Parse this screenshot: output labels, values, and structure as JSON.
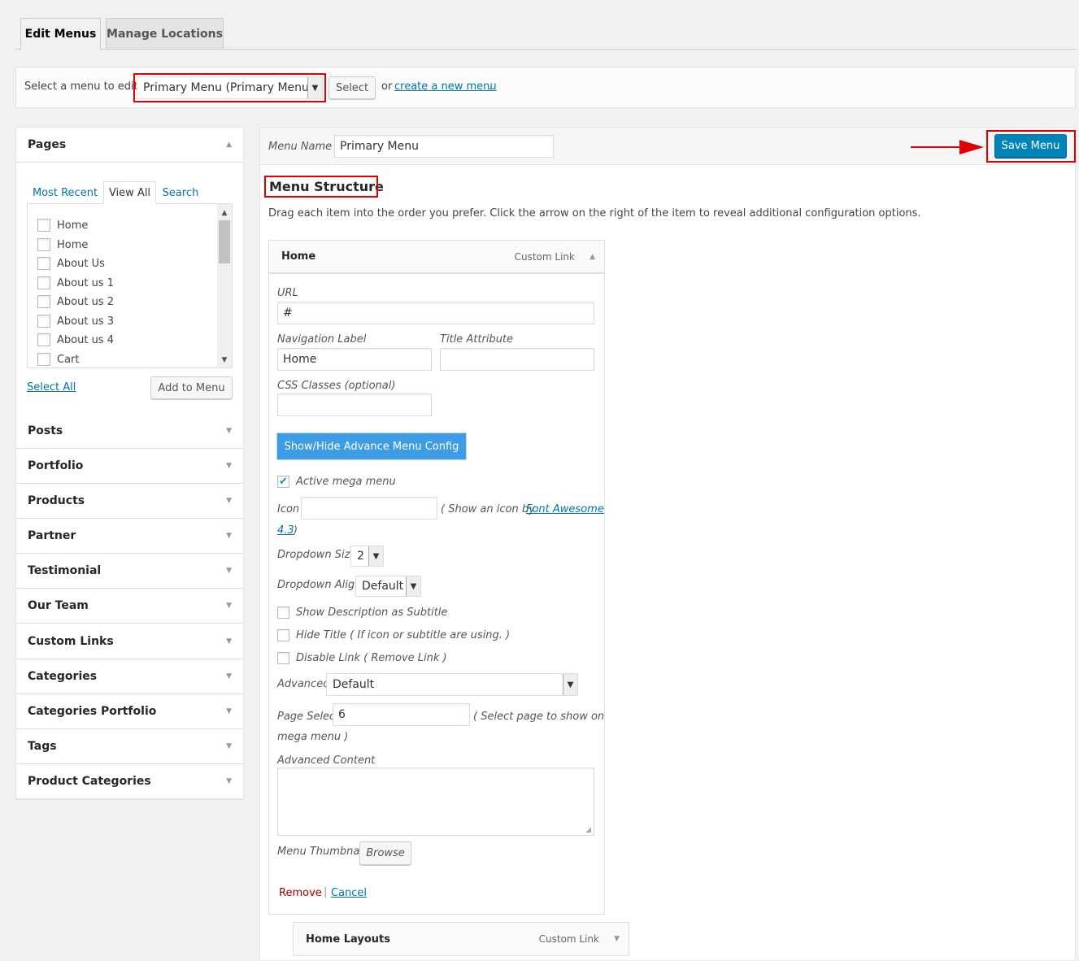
{
  "tabs": [
    {
      "label": "Edit Menus",
      "active": true
    },
    {
      "label": "Manage Locations",
      "active": false
    }
  ],
  "manage": {
    "prompt": "Select a menu to edit:",
    "selected_menu": "Primary Menu (Primary Menu)",
    "select_button": "Select",
    "or_text": "or",
    "create_link": "create a new menu",
    "period": "."
  },
  "sidebar": {
    "pages": {
      "title": "Pages",
      "tabs": [
        "Most Recent",
        "View All",
        "Search"
      ],
      "active_tab": "View All",
      "items": [
        "Home",
        "Home",
        "About Us",
        "About us 1",
        "About us 2",
        "About us 3",
        "About us 4",
        "Cart"
      ],
      "select_all": "Select All",
      "add_button": "Add to Menu"
    },
    "sections": [
      "Posts",
      "Portfolio",
      "Products",
      "Partner",
      "Testimonial",
      "Our Team",
      "Custom Links",
      "Categories",
      "Categories Portfolio",
      "Tags",
      "Product Categories"
    ]
  },
  "editor": {
    "menu_name_label": "Menu Name",
    "menu_name_value": "Primary Menu",
    "save_button": "Save Menu",
    "structure_title": "Menu Structure",
    "structure_desc": "Drag each item into the order you prefer. Click the arrow on the right of the item to reveal additional configuration options.",
    "item": {
      "title": "Home",
      "type": "Custom Link",
      "url_label": "URL",
      "url_value": "#",
      "nav_label_label": "Navigation Label",
      "nav_label_value": "Home",
      "title_attr_label": "Title Attribute",
      "title_attr_value": "",
      "css_label": "CSS Classes (optional)",
      "css_value": "",
      "advance_button": "Show/Hide Advance Menu Config",
      "active_mega_label": "Active mega menu",
      "active_mega_checked": true,
      "icon_label": "Icon",
      "icon_value": "",
      "icon_hint_pre": "( Show an icon by",
      "icon_hint_link_a": "Font Awesome",
      "icon_hint_link_b": "4.3",
      "icon_hint_post": ")",
      "dropdown_size_label": "Dropdown Size",
      "dropdown_size_value": "2",
      "dropdown_align_label": "Dropdown Align",
      "dropdown_align_value": "Default",
      "show_desc_label": "Show Description as Subtitle",
      "hide_title_label": "Hide Title ( If icon or subtitle are using. )",
      "disable_link_label": "Disable Link ( Remove Link )",
      "advanced_label": "Advanced",
      "advanced_value": "Default",
      "page_select_label": "Page Select",
      "page_select_value": "6",
      "page_select_hint_a": "( Select page to show on",
      "page_select_hint_b": "mega menu )",
      "advanced_content_label": "Advanced Content",
      "thumbnail_label": "Menu Thumbnail",
      "browse_button": "Browse",
      "remove_link": "Remove",
      "separator": "|",
      "cancel_link": "Cancel"
    },
    "next_item": {
      "title": "Home Layouts",
      "type": "Custom Link"
    }
  },
  "colors": {
    "accent": "#0073aa",
    "primary_button": "#0085ba",
    "advance_button": "#3e9ce5",
    "highlight": "#e00000",
    "remove_link": "#a00000"
  }
}
